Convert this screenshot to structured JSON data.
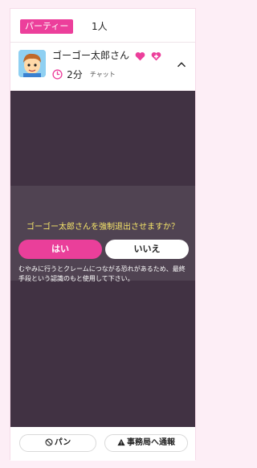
{
  "header": {
    "party_tag": "パーティー",
    "member_count": "1人"
  },
  "user": {
    "name": "ゴーゴー太郎さん",
    "badges": [
      "heart-icon",
      "heart-plus-icon"
    ],
    "duration": "2分",
    "status": "チャット"
  },
  "dialog": {
    "question": "ゴーゴー太郎さんを強制退出させますか？",
    "yes_label": "はい",
    "no_label": "いいえ",
    "warning": "むやみに行うとクレームにつながる恐れがあるため、最終手段という認識のもと使用して下さい。"
  },
  "footer": {
    "ban_label": "パン",
    "report_label": "事務局へ通報"
  },
  "colors": {
    "accent": "#ea3f9a",
    "chat_bg": "#413243",
    "dialog_text": "#f6e66a"
  }
}
